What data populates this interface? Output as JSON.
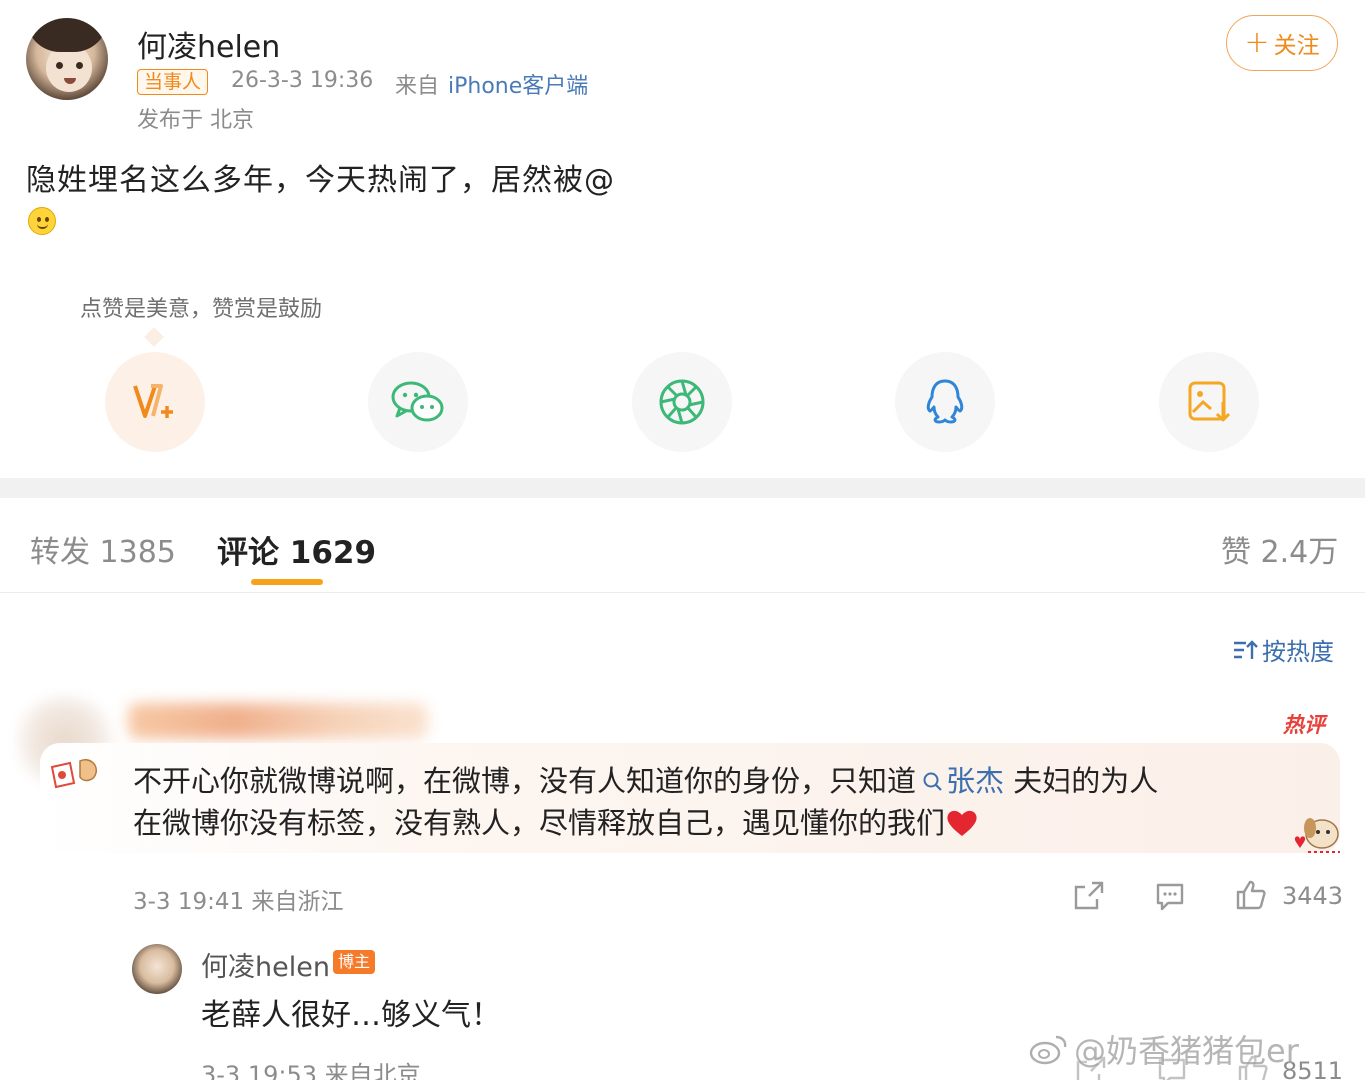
{
  "post": {
    "author": "何凌helen",
    "party_badge": "当事人",
    "time": "26-3-3 19:36",
    "from_label": "来自",
    "device": "iPhone客户端",
    "location": "发布于 北京",
    "follow_label": "关注",
    "text": "隐姓埋名这么多年，今天热闹了，居然被@",
    "emoji": "smiley-icon"
  },
  "reward": {
    "tip": "点赞是美意，赞赏是鼓励"
  },
  "share_targets": [
    {
      "name": "weibo-v-plus-icon"
    },
    {
      "name": "wechat-icon"
    },
    {
      "name": "moments-icon"
    },
    {
      "name": "qq-icon"
    },
    {
      "name": "save-image-icon"
    }
  ],
  "tabs": {
    "repost": "转发 1385",
    "comments": "评论 1629",
    "likes": "赞 2.4万"
  },
  "sort_label": "按热度",
  "hot_comment": {
    "tag": "热评",
    "line1_a": "不开心你就微博说啊，在微博，没有人知道你的身份，只知道",
    "mention": "张杰",
    "line1_b": " 夫妇的为人",
    "line2": "在微博你没有标签，没有熟人，尽情释放自己，遇见懂你的我们",
    "meta": "3-3 19:41  来自浙江",
    "likes": "3443"
  },
  "reply": {
    "author": "何凌helen",
    "badge": "博主",
    "text": "老薛人很好…够义气！",
    "meta": "3-3 19:53  来自北京",
    "likes": "8511"
  },
  "watermark": "@奶香猪猪包er",
  "colors": {
    "accent_orange": "#f08a1c",
    "link_blue": "#3d6fae",
    "hot_red": "#e8413b",
    "muted": "#8c8c8c"
  }
}
